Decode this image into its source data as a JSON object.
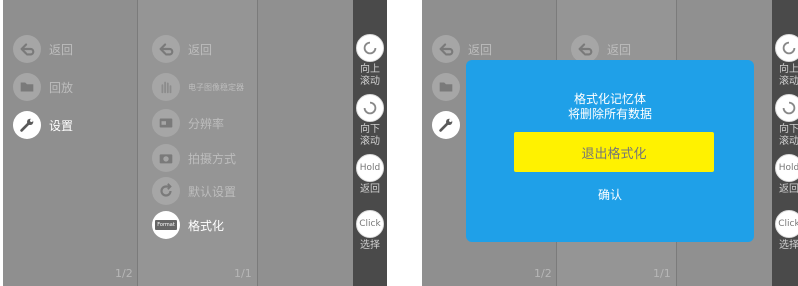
{
  "left_screen": {
    "page1": {
      "items": [
        {
          "label": "返回",
          "icon": "back-arrow-icon"
        },
        {
          "label": "回放",
          "icon": "folder-icon"
        },
        {
          "label": "设置",
          "icon": "wrench-icon"
        }
      ],
      "page_indicator": "1/2"
    },
    "page2": {
      "items": [
        {
          "label": "返回",
          "icon": "back-arrow-icon"
        },
        {
          "label": "电子图像稳定器",
          "icon": "hand-stabilizer-icon"
        },
        {
          "label": "分辨率",
          "icon": "resolution-icon"
        },
        {
          "label": "拍摄方式",
          "icon": "camera-icon"
        },
        {
          "label": "默认设置",
          "icon": "reset-icon"
        },
        {
          "label": "格式化",
          "icon": "format-icon"
        }
      ],
      "format_icon_text": "Format",
      "page_indicator": "1/1"
    },
    "sidebar": [
      {
        "label": "向上\n滚动",
        "icon": "scroll-up-icon"
      },
      {
        "label": "向下\n滚动",
        "icon": "scroll-down-icon"
      },
      {
        "label": "返回",
        "icon": "hold-button-icon",
        "icon_text": "Hold"
      },
      {
        "label": "选择",
        "icon": "click-button-icon",
        "icon_text": "Click"
      }
    ]
  },
  "right_screen": {
    "page1_items": [
      {
        "label": "返回",
        "icon": "back-arrow-icon"
      },
      {
        "label": "",
        "icon": "folder-icon"
      },
      {
        "label": "",
        "icon": "wrench-icon"
      }
    ],
    "page2_items": [
      {
        "label": "返回",
        "icon": "back-arrow-icon"
      }
    ],
    "page_indicator_1": "1/2",
    "page_indicator_2": "1/1",
    "dialog": {
      "message_line1": "格式化记忆体",
      "message_line2": "将删除所有数据",
      "exit_label": "退出格式化",
      "confirm_label": "确认"
    },
    "sidebar": [
      {
        "label": "向上\n滚动",
        "icon": "scroll-up-icon"
      },
      {
        "label": "向下\n滚动",
        "icon": "scroll-down-icon"
      },
      {
        "label": "返回",
        "icon": "hold-button-icon",
        "icon_text": "Hold"
      },
      {
        "label": "选择",
        "icon": "click-button-icon",
        "icon_text": "Click"
      }
    ]
  },
  "colors": {
    "dialog_bg": "#1fa0e8",
    "exit_button_bg": "#fff200",
    "sidebar_bg": "#4a4a4a"
  }
}
